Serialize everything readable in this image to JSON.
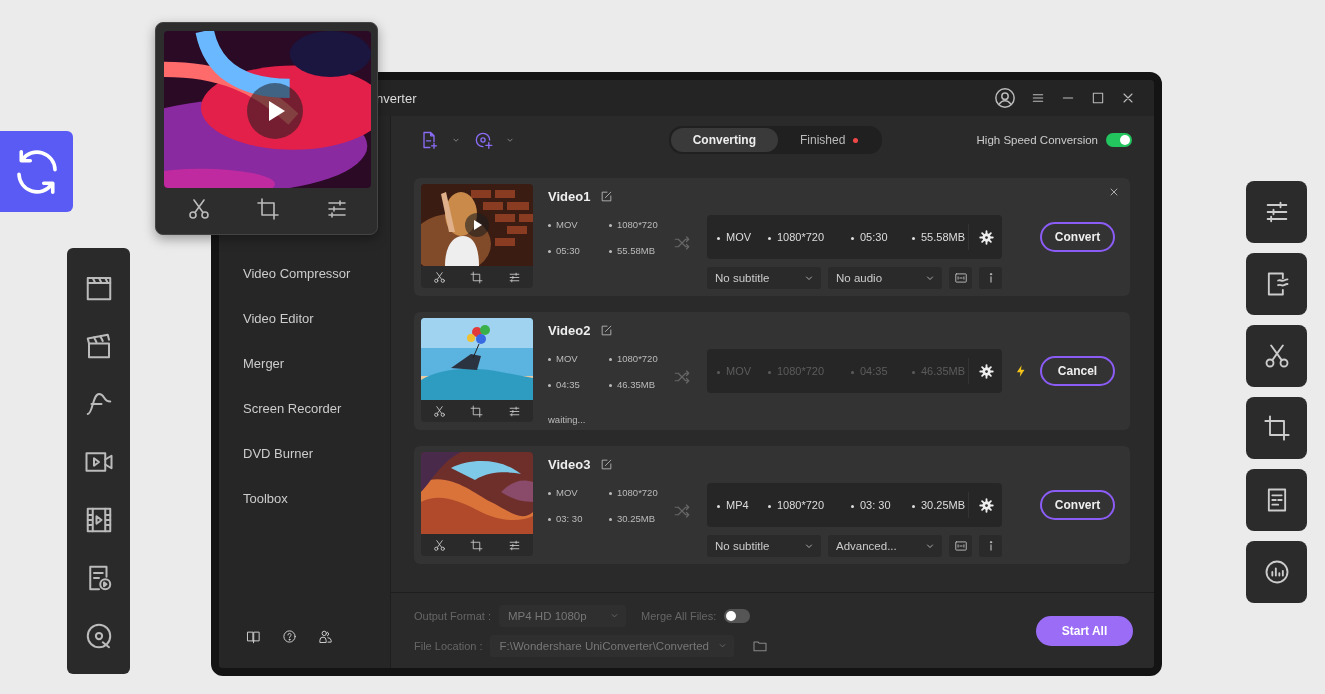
{
  "window": {
    "title": "nverter"
  },
  "sidebar": {
    "items": [
      "Video Compressor",
      "Video Editor",
      "Merger",
      "Screen Recorder",
      "DVD Burner",
      "Toolbox"
    ]
  },
  "tabs": [
    {
      "label": "Converting",
      "selected": true,
      "badge_dot": false
    },
    {
      "label": "Finished",
      "selected": false,
      "badge_dot": true
    }
  ],
  "high_speed_conversion": {
    "label": "High Speed Conversion",
    "on": true
  },
  "videos": [
    {
      "kind": "ready",
      "title": "Video1",
      "closable": true,
      "play_button": true,
      "source": [
        "MOV",
        "1080*720",
        "05:30",
        "55.58MB"
      ],
      "target": [
        "MOV",
        "1080*720",
        "05:30",
        "55.58MB"
      ],
      "subtitle": "No subtitle",
      "audio": "No audio",
      "action": "Convert"
    },
    {
      "kind": "queued",
      "title": "Video2",
      "closable": false,
      "play_button": false,
      "source": [
        "MOV",
        "1080*720",
        "04:35",
        "46.35MB"
      ],
      "target": [
        "MOV",
        "1080*720",
        "04:35",
        "46.35MB"
      ],
      "level": 0,
      "status": "waiting...",
      "action": "Cancel"
    },
    {
      "kind": "ready",
      "title": "Video3",
      "closable": false,
      "play_button": false,
      "source": [
        "MOV",
        "1080*720",
        "03: 30",
        "30.25MB"
      ],
      "target": [
        "MP4",
        "1080*720",
        "03: 30",
        "30.25MB"
      ],
      "subtitle": "No subtitle",
      "audio": "Advanced...",
      "action": "Convert"
    }
  ],
  "footer": {
    "output_format_label": "Output Format :",
    "output_format": "MP4 HD 1080p",
    "merge_label": "Merge All Files:",
    "merge_on": false,
    "file_location_label": "File Location :",
    "file_location": "F:\\Wondershare UniConverter\\Converted",
    "start_all": "Start All"
  }
}
